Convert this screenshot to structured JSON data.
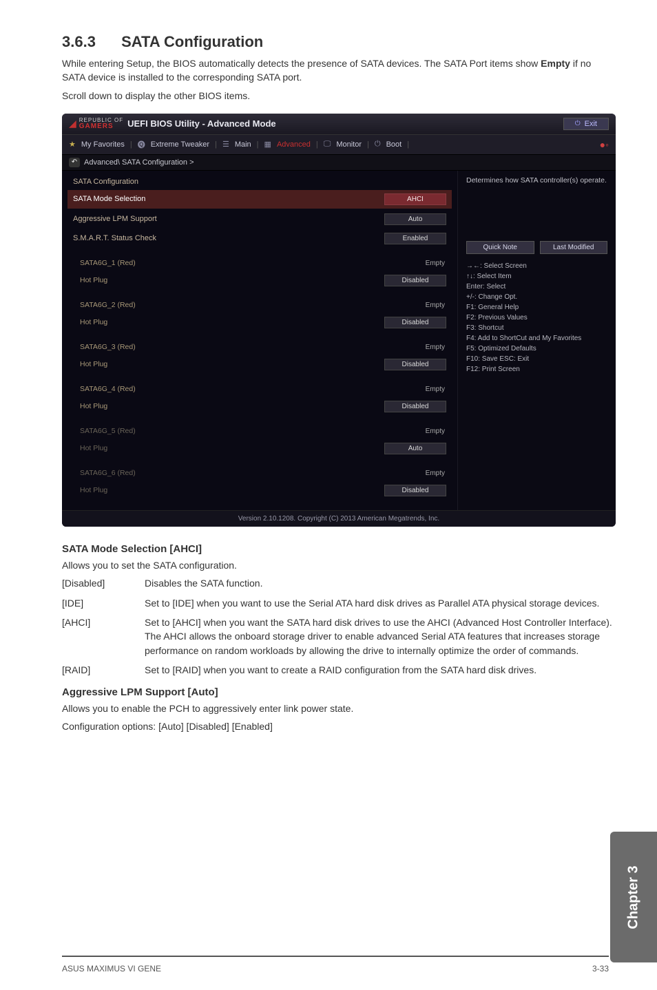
{
  "section": {
    "number": "3.6.3",
    "title": "SATA Configuration"
  },
  "intro": {
    "line1a": "While entering Setup, the BIOS automatically detects the presence of SATA devices. The SATA Port items show ",
    "line1b": "Empty",
    "line1c": " if no SATA device is installed to the corresponding SATA port.",
    "line2": "Scroll down to display the other BIOS items."
  },
  "bios": {
    "logo1": "REPUBLIC OF",
    "logo2": "GAMERS",
    "title": "UEFI BIOS Utility - Advanced Mode",
    "exit": "Exit",
    "tabs": {
      "fav": "My Favorites",
      "tweaker": "Extreme Tweaker",
      "main": "Main",
      "advanced": "Advanced",
      "monitor": "Monitor",
      "boot": "Boot"
    },
    "crumb": "Advanced\\ SATA Configuration >",
    "left": {
      "head": "SATA Configuration",
      "mode_sel": {
        "label": "SATA Mode Selection",
        "value": "AHCI"
      },
      "lpm": {
        "label": "Aggressive LPM Support",
        "value": "Auto"
      },
      "smart": {
        "label": "S.M.A.R.T. Status Check",
        "value": "Enabled"
      },
      "ports": [
        {
          "name": "SATA6G_1 (Red)",
          "state": "Empty",
          "hp_label": "Hot Plug",
          "hp_value": "Disabled"
        },
        {
          "name": "SATA6G_2 (Red)",
          "state": "Empty",
          "hp_label": "Hot Plug",
          "hp_value": "Disabled"
        },
        {
          "name": "SATA6G_3 (Red)",
          "state": "Empty",
          "hp_label": "Hot Plug",
          "hp_value": "Disabled"
        },
        {
          "name": "SATA6G_4 (Red)",
          "state": "Empty",
          "hp_label": "Hot Plug",
          "hp_value": "Disabled"
        },
        {
          "name": "SATA6G_5 (Red)",
          "state": "Empty",
          "hp_label": "Hot Plug",
          "hp_value": "Auto"
        },
        {
          "name": "SATA6G_6 (Red)",
          "state": "Empty",
          "hp_label": "Hot Plug",
          "hp_value": "Disabled"
        }
      ]
    },
    "right": {
      "help": "Determines how SATA controller(s) operate.",
      "quick": "Quick Note",
      "last": "Last Modified",
      "hints": [
        "→←: Select Screen",
        "↑↓: Select Item",
        "Enter: Select",
        "+/-: Change Opt.",
        "F1: General Help",
        "F2: Previous Values",
        "F3: Shortcut",
        "F4: Add to ShortCut and My Favorites",
        "F5: Optimized Defaults",
        "F10: Save  ESC: Exit",
        "F12: Print Screen"
      ]
    },
    "footer": "Version 2.10.1208. Copyright (C) 2013 American Megatrends, Inc."
  },
  "mode_sel_section": {
    "heading": "SATA Mode Selection [AHCI]",
    "lead": "Allows you to set the SATA configuration.",
    "opts": [
      {
        "k": "[Disabled]",
        "v": "Disables the SATA function."
      },
      {
        "k": "[IDE]",
        "v": "Set to [IDE] when you want to use the Serial ATA hard disk drives as Parallel ATA physical storage devices."
      },
      {
        "k": "[AHCI]",
        "v": "Set to [AHCI] when you want the SATA hard disk drives to use the AHCI (Advanced Host Controller Interface). The AHCI allows the onboard storage driver to enable advanced Serial ATA features that increases storage performance on random workloads by allowing the drive to internally optimize the order of commands."
      },
      {
        "k": "[RAID]",
        "v": "Set to [RAID] when you want to create a RAID configuration from the SATA hard disk drives."
      }
    ]
  },
  "lpm_section": {
    "heading": "Aggressive LPM Support [Auto]",
    "line1": "Allows you to enable the PCH to aggressively enter link power state.",
    "line2": "Configuration options: [Auto] [Disabled] [Enabled]"
  },
  "side_tab": "Chapter 3",
  "footer": {
    "product": "ASUS MAXIMUS VI GENE",
    "page": "3-33"
  }
}
